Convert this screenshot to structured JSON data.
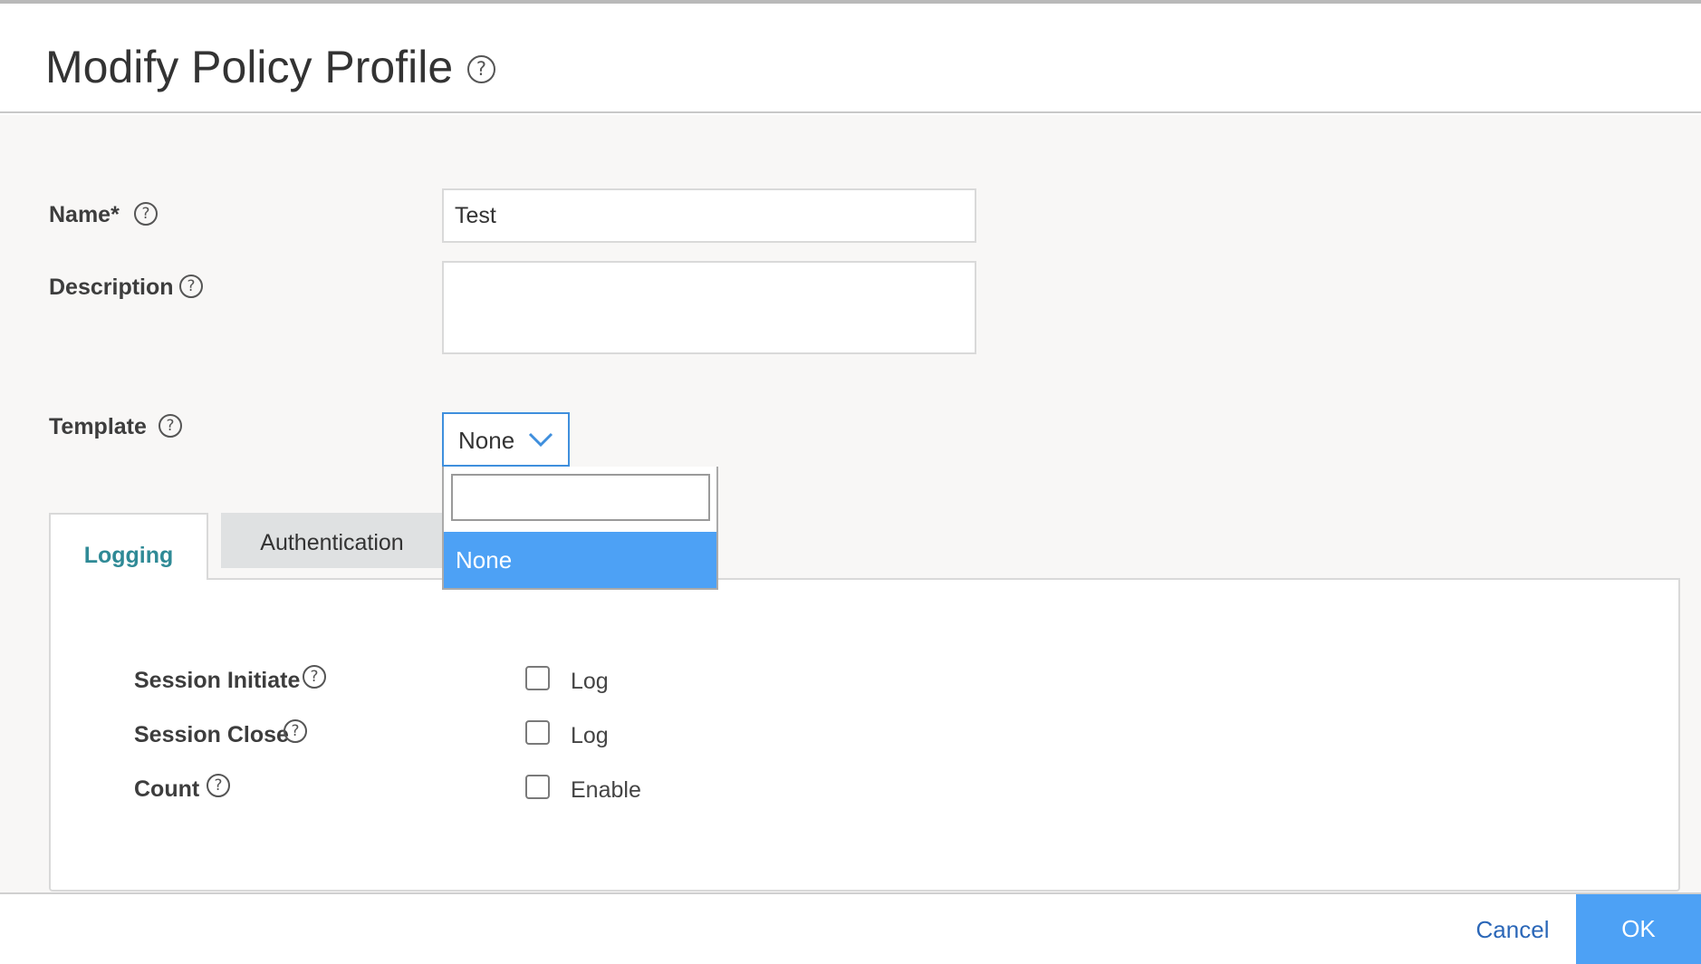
{
  "dialog": {
    "title": "Modify Policy Profile",
    "help_icon": "question-circle-icon"
  },
  "form": {
    "name": {
      "label": "Name*",
      "value": "Test"
    },
    "description": {
      "label": "Description",
      "value": ""
    },
    "template": {
      "label": "Template",
      "selected": "None",
      "dropdown": {
        "search_value": "",
        "options": [
          "None"
        ],
        "highlighted": "None"
      }
    }
  },
  "tabs": [
    {
      "label": "Logging",
      "active": true
    },
    {
      "label": "Authentication",
      "active": false
    }
  ],
  "logging": {
    "rows": [
      {
        "label": "Session Initiate",
        "checkbox_label": "Log",
        "checked": false
      },
      {
        "label": "Session Close",
        "checkbox_label": "Log",
        "checked": false
      },
      {
        "label": "Count",
        "checkbox_label": "Enable",
        "checked": false
      }
    ]
  },
  "footer": {
    "cancel_label": "Cancel",
    "ok_label": "OK"
  },
  "colors": {
    "accent_blue": "#4da1f5",
    "link_blue": "#2b67b8",
    "active_tab_teal": "#2f8a96",
    "focus_border": "#3f8fdd"
  }
}
